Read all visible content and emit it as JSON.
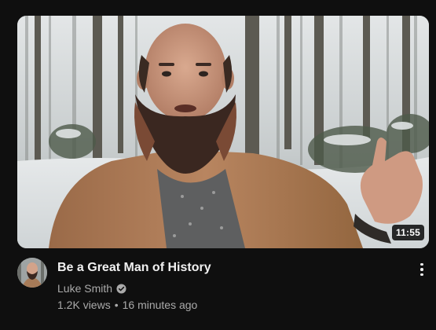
{
  "video": {
    "title": "Be a Great Man of History",
    "duration": "11:55",
    "channel": "Luke Smith",
    "verified": true,
    "views": "1.2K views",
    "separator": "•",
    "posted": "16 minutes ago"
  },
  "icons": {
    "verified": "verified-check-icon",
    "menu": "more-vert-icon"
  },
  "colors": {
    "background": "#0f0f0f",
    "title": "#f1f1f1",
    "secondary_text": "#aaaaaa",
    "duration_badge": "#000000"
  }
}
